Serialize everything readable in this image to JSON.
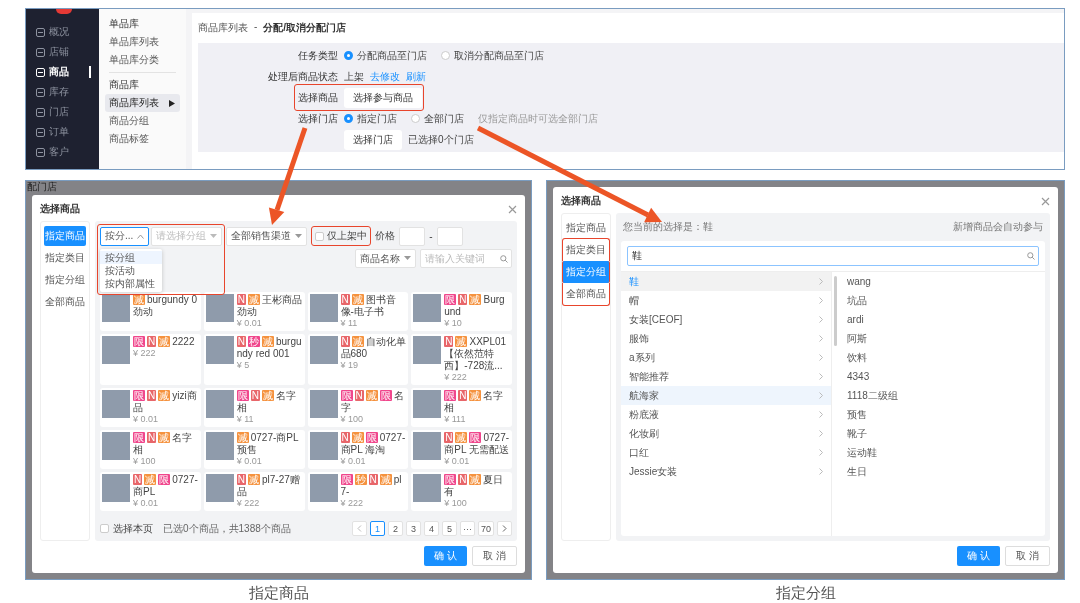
{
  "top_screen": {
    "nav": [
      {
        "label": "概况",
        "selected": false
      },
      {
        "label": "店铺",
        "selected": false
      },
      {
        "label": "商品",
        "selected": true
      },
      {
        "label": "库存",
        "selected": false
      },
      {
        "label": "门店",
        "selected": false
      },
      {
        "label": "订单",
        "selected": false
      },
      {
        "label": "客户",
        "selected": false
      }
    ],
    "subnav": [
      {
        "title": "单品库",
        "items": [
          {
            "label": "单品库列表",
            "selected": false
          },
          {
            "label": "单品库分类",
            "selected": false
          }
        ]
      },
      {
        "title": "商品库",
        "items": [
          {
            "label": "商品库列表",
            "selected": true
          },
          {
            "label": "商品分组",
            "selected": false
          },
          {
            "label": "商品标签",
            "selected": false
          }
        ]
      }
    ],
    "breadcrumb": {
      "parent": "商品库列表",
      "separator": "-",
      "current": "分配/取消分配门店"
    },
    "form": {
      "task_type": {
        "label": "任务类型",
        "options": [
          {
            "label": "分配商品至门店",
            "selected": true
          },
          {
            "label": "取消分配商品至门店",
            "selected": false
          }
        ]
      },
      "status": {
        "label": "处理后商品状态",
        "value": "上架",
        "links": [
          "去修改",
          "刷新"
        ]
      },
      "goods": {
        "label": "选择商品",
        "button": "选择参与商品",
        "highlighted": true
      },
      "store": {
        "label": "选择门店",
        "options": [
          {
            "label": "指定门店",
            "selected": true
          },
          {
            "label": "全部门店",
            "selected": false
          }
        ],
        "hint": "仅指定商品时可选全部门店"
      },
      "store_button": {
        "button": "选择门店",
        "summary": "已选择0个门店"
      }
    }
  },
  "goods_screen": {
    "backdrop_text": "配门店",
    "title": "选择商品",
    "tabs": [
      {
        "label": "指定商品",
        "selected": true
      },
      {
        "label": "指定类目",
        "selected": false
      },
      {
        "label": "指定分组",
        "selected": false
      },
      {
        "label": "全部商品",
        "selected": false
      }
    ],
    "filters": {
      "highlighted": true,
      "mode": {
        "value": "按分...",
        "expanded": true,
        "options": [
          {
            "label": "按分组",
            "selected": true
          },
          {
            "label": "按活动",
            "selected": false
          },
          {
            "label": "按内部属性",
            "selected": false
          }
        ]
      },
      "group": {
        "placeholder": "请选择分组"
      },
      "channel": {
        "value": "全部销售渠道"
      },
      "on_sale": {
        "label": "仅上架中",
        "checked": false,
        "highlighted": true
      },
      "price_label": "价格",
      "price_separator": "-",
      "field": {
        "value": "商品名称"
      },
      "keyword": {
        "placeholder": "请输入关键词"
      }
    },
    "products": [
      {
        "name": "burgundy 0 劲动",
        "tags": [
          {
            "text": "减",
            "color": "#f5923e"
          }
        ]
      },
      {
        "name": "王彬商品劲动",
        "price": "¥ 0.01",
        "tags": [
          {
            "text": "N",
            "color": "#e8666a"
          },
          {
            "text": "减",
            "color": "#f5923e"
          }
        ]
      },
      {
        "name": "图书音像-电子书",
        "price": "¥ 11",
        "tags": [
          {
            "text": "N",
            "color": "#e8666a"
          },
          {
            "text": "减",
            "color": "#f5923e"
          }
        ]
      },
      {
        "name": "Burgund",
        "price": "¥ 10",
        "tags": [
          {
            "text": "限",
            "color": "#f0468c"
          },
          {
            "text": "N",
            "color": "#e8666a"
          },
          {
            "text": "减",
            "color": "#f5923e"
          }
        ]
      },
      {
        "name": "2222",
        "price": "¥ 222",
        "tags": [
          {
            "text": "限",
            "color": "#f0468c"
          },
          {
            "text": "N",
            "color": "#e8666a"
          },
          {
            "text": "减",
            "color": "#f5923e"
          }
        ]
      },
      {
        "name": "burgundy red 001",
        "price": "¥ 5",
        "tags": [
          {
            "text": "N",
            "color": "#e8666a"
          },
          {
            "text": "秒",
            "color": "#f0468c"
          },
          {
            "text": "减",
            "color": "#f5923e"
          }
        ]
      },
      {
        "name": "自动化单品680",
        "price": "¥ 19",
        "tags": [
          {
            "text": "N",
            "color": "#e8666a"
          },
          {
            "text": "减",
            "color": "#f5923e"
          }
        ]
      },
      {
        "name": "XXPL01【依然范特西】-728流...",
        "price": "¥ 222",
        "tags": [
          {
            "text": "N",
            "color": "#e8666a"
          },
          {
            "text": "减",
            "color": "#f5923e"
          }
        ]
      },
      {
        "name": "yizi商品",
        "price": "¥ 0.01",
        "tags": [
          {
            "text": "限",
            "color": "#f0468c"
          },
          {
            "text": "N",
            "color": "#e8666a"
          },
          {
            "text": "减",
            "color": "#f5923e"
          }
        ]
      },
      {
        "name": "名字相",
        "price": "¥ 11",
        "tags": [
          {
            "text": "限",
            "color": "#f0468c"
          },
          {
            "text": "N",
            "color": "#e8666a"
          },
          {
            "text": "减",
            "color": "#f5923e"
          }
        ]
      },
      {
        "name": "名字",
        "price": "¥ 100",
        "tags": [
          {
            "text": "限",
            "color": "#f0468c"
          },
          {
            "text": "N",
            "color": "#e8666a"
          },
          {
            "text": "减",
            "color": "#f5923e"
          },
          {
            "text": "限",
            "color": "#f0468c"
          }
        ]
      },
      {
        "name": "名字相",
        "price": "¥ 111",
        "tags": [
          {
            "text": "限",
            "color": "#f0468c"
          },
          {
            "text": "N",
            "color": "#e8666a"
          },
          {
            "text": "减",
            "color": "#f5923e"
          }
        ]
      },
      {
        "name": "名字相",
        "price": "¥ 100",
        "tags": [
          {
            "text": "限",
            "color": "#f0468c"
          },
          {
            "text": "N",
            "color": "#e8666a"
          },
          {
            "text": "减",
            "color": "#f5923e"
          }
        ]
      },
      {
        "name": "0727-商PL 预售",
        "price": "¥ 0.01",
        "tags": [
          {
            "text": "减",
            "color": "#f5923e"
          }
        ]
      },
      {
        "name": "0727-商PL 海淘",
        "price": "¥ 0.01",
        "tags": [
          {
            "text": "N",
            "color": "#e8666a"
          },
          {
            "text": "减",
            "color": "#f5923e"
          },
          {
            "text": "限",
            "color": "#f0468c"
          }
        ]
      },
      {
        "name": "0727-商PL 无需配送",
        "price": "¥ 0.01",
        "tags": [
          {
            "text": "N",
            "color": "#e8666a"
          },
          {
            "text": "减",
            "color": "#f5923e"
          },
          {
            "text": "限",
            "color": "#f0468c"
          }
        ]
      },
      {
        "name": "0727-商PL",
        "price": "¥ 0.01",
        "tags": [
          {
            "text": "N",
            "color": "#e8666a"
          },
          {
            "text": "减",
            "color": "#f5923e"
          },
          {
            "text": "限",
            "color": "#f0468c"
          }
        ]
      },
      {
        "name": "pl7-27赠品",
        "price": "¥ 222",
        "tags": [
          {
            "text": "N",
            "color": "#e8666a"
          },
          {
            "text": "减",
            "color": "#f5923e"
          }
        ]
      },
      {
        "name": "pl7-",
        "price": "¥ 222",
        "tags": [
          {
            "text": "限",
            "color": "#f0468c"
          },
          {
            "text": "秒",
            "color": "#f5923e"
          },
          {
            "text": "N",
            "color": "#e8666a"
          },
          {
            "text": "减",
            "color": "#f5923e"
          }
        ]
      },
      {
        "name": "夏日有",
        "price": "¥ 100",
        "tags": [
          {
            "text": "限",
            "color": "#f0468c"
          },
          {
            "text": "N",
            "color": "#e8666a"
          },
          {
            "text": "减",
            "color": "#f5923e"
          }
        ]
      }
    ],
    "footer": {
      "select_page": {
        "label": "选择本页",
        "checked": false
      },
      "summary": "已选0个商品，共1388个商品",
      "pages": [
        {
          "label": "1",
          "selected": true
        },
        {
          "label": "2",
          "selected": false
        },
        {
          "label": "3",
          "selected": false
        },
        {
          "label": "4",
          "selected": false
        },
        {
          "label": "5",
          "selected": false
        },
        {
          "label": "···",
          "selected": false
        },
        {
          "label": "70",
          "selected": false
        }
      ]
    },
    "buttons": {
      "confirm": "确 认",
      "cancel": "取 消"
    }
  },
  "group_screen": {
    "title": "选择商品",
    "tabs": [
      {
        "label": "指定商品",
        "selected": false,
        "highlighted": false
      },
      {
        "label": "指定类目",
        "selected": false,
        "highlighted": true
      },
      {
        "label": "指定分组",
        "selected": true,
        "highlighted": true
      },
      {
        "label": "全部商品",
        "selected": false,
        "highlighted": true
      }
    ],
    "current": "您当前的选择是：鞋",
    "note": "新增商品会自动参与",
    "search": {
      "value": "鞋"
    },
    "groups": [
      {
        "label": "鞋",
        "selected": true,
        "hovered": false
      },
      {
        "label": "帽",
        "selected": false,
        "hovered": false
      },
      {
        "label": "女装[CEOF]",
        "selected": false,
        "hovered": false
      },
      {
        "label": "服饰",
        "selected": false,
        "hovered": false
      },
      {
        "label": "a系列",
        "selected": false,
        "hovered": false
      },
      {
        "label": "智能推荐",
        "selected": false,
        "hovered": false
      },
      {
        "label": "航海家",
        "selected": false,
        "hovered": true
      },
      {
        "label": "粉底液",
        "selected": false,
        "hovered": false
      },
      {
        "label": "化妆刷",
        "selected": false,
        "hovered": false
      },
      {
        "label": "口红",
        "selected": false,
        "hovered": false
      },
      {
        "label": "Jessie女装",
        "selected": false,
        "hovered": false
      }
    ],
    "subgroups": [
      "wang",
      "坑品",
      "ardi",
      "阿斯",
      "饮料",
      "4343",
      "1118二级组",
      "预售",
      "靴子",
      "运动鞋",
      "生日"
    ],
    "buttons": {
      "confirm": "确 认",
      "cancel": "取 消"
    }
  },
  "captions": [
    "指定商品",
    "指定分组"
  ]
}
